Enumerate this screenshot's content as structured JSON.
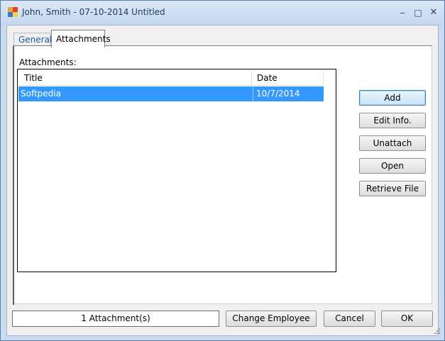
{
  "window": {
    "title": "John, Smith - 07-10-2014 Untitled",
    "controls": {
      "minimize": "‒",
      "maximize": "□",
      "close": "✕"
    }
  },
  "tabs": [
    {
      "label": "General",
      "active": false
    },
    {
      "label": "Attachments",
      "active": true
    }
  ],
  "attachments": {
    "label": "Attachments:",
    "columns": [
      "Title",
      "Date"
    ],
    "rows": [
      {
        "title": "Softpedia",
        "date": "10/7/2014",
        "selected": true
      }
    ]
  },
  "side_buttons": {
    "add": "Add",
    "edit_info": "Edit Info.",
    "unattach": "Unattach",
    "open": "Open",
    "retrieve_file": "Retrieve File"
  },
  "footer": {
    "status": "1 Attachment(s)",
    "change_employee": "Change Employee",
    "cancel": "Cancel",
    "ok": "OK"
  },
  "colors": {
    "selection": "#3399ff",
    "frame": "#c9dbef",
    "tab_text": "#1f5ca8"
  },
  "icons": [
    "app-icon",
    "minimize-icon",
    "maximize-icon",
    "close-icon",
    "resize-grip-icon"
  ]
}
